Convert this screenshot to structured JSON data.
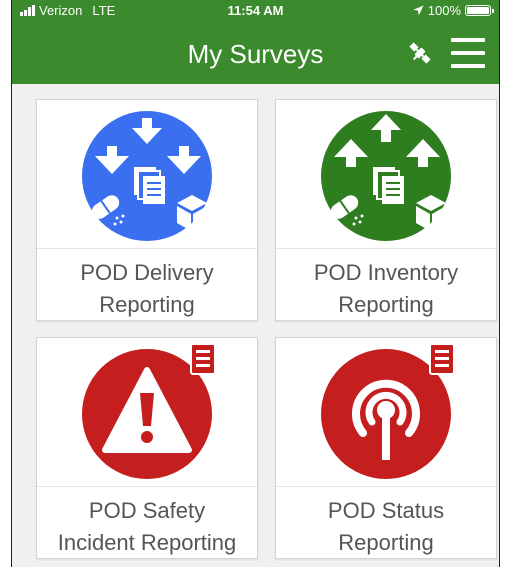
{
  "status_bar": {
    "carrier": "Verizon",
    "network": "LTE",
    "time": "11:54 AM",
    "battery": "100%"
  },
  "header": {
    "title": "My Surveys",
    "color": "#3b8a2e"
  },
  "surveys": [
    {
      "line1": "POD Delivery",
      "line2": "Reporting",
      "icon": "delivery-icon",
      "color": "#3a6ff0"
    },
    {
      "line1": "POD Inventory",
      "line2": "Reporting",
      "icon": "inventory-icon",
      "color": "#2e7d1f"
    },
    {
      "line1": "POD Safety",
      "line2": "Incident Reporting",
      "icon": "warning-icon",
      "color": "#c41e1e"
    },
    {
      "line1": "POD Status",
      "line2": "Reporting",
      "icon": "broadcast-icon",
      "color": "#c41e1e"
    }
  ]
}
